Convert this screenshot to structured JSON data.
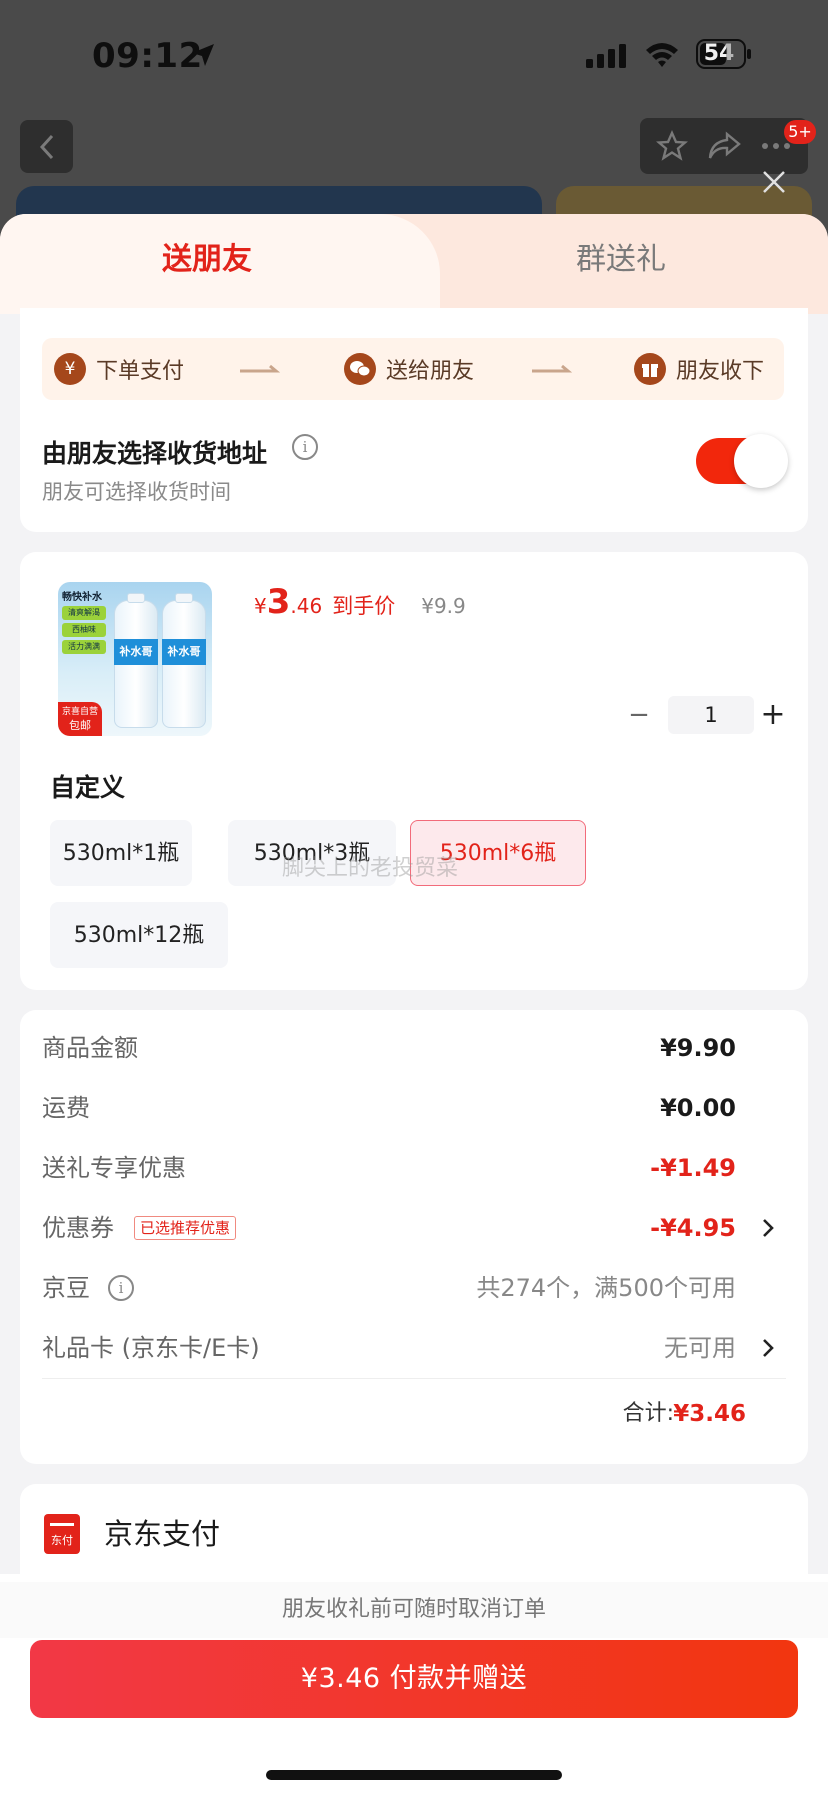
{
  "status_bar": {
    "time": "09:12",
    "battery": "54"
  },
  "nav": {
    "badge": "5+"
  },
  "tabs": [
    {
      "label": "送朋友",
      "active": true
    },
    {
      "label": "群送礼",
      "active": false
    }
  ],
  "steps": [
    {
      "label": "下单支付",
      "icon": "yen-circle-icon",
      "glyph": "¥"
    },
    {
      "label": "送给朋友",
      "icon": "wechat-icon"
    },
    {
      "label": "朋友收下",
      "icon": "gift-icon"
    }
  ],
  "address_option": {
    "title": "由朋友选择收货地址",
    "subtitle": "朋友可选择收货时间",
    "enabled": true
  },
  "product": {
    "image_text": {
      "tag": "畅快补水",
      "chips": [
        "清爽解渴",
        "西柚味",
        "活力满满"
      ],
      "bottle_label": "补水哥",
      "corner_top": "京喜自营",
      "corner_bottom": "包邮"
    },
    "price_symbol": "¥",
    "price_int": "3",
    "price_dec": ".46",
    "price_tag": "到手价",
    "original_price": "¥9.9",
    "quantity": "1",
    "spec_title": "自定义",
    "specs": [
      {
        "label": "530ml*1瓶",
        "selected": false
      },
      {
        "label": "530ml*3瓶",
        "selected": false
      },
      {
        "label": "530ml*6瓶",
        "selected": true
      },
      {
        "label": "530ml*12瓶",
        "selected": false
      }
    ],
    "watermark": "脚尖上的老投贸菜"
  },
  "summary": {
    "goods_label": "商品金额",
    "goods_value": "¥9.90",
    "shipping_label": "运费",
    "shipping_value": "¥0.00",
    "gift_discount_label": "送礼专享优惠",
    "gift_discount_value": "-¥1.49",
    "coupon_label": "优惠券",
    "coupon_tag": "已选推荐优惠",
    "coupon_value": "-¥4.95",
    "jd_beans_label": "京豆",
    "jd_beans_value": "共274个，满500个可用",
    "gift_card_label": "礼品卡 (京东卡/E卡)",
    "gift_card_value": "无可用",
    "total_label": "合计:",
    "total_value": "¥3.46"
  },
  "payment": {
    "icon_text": "东付",
    "name": "京东支付"
  },
  "footer": {
    "note": "朋友收礼前可随时取消订单",
    "pay_button": "¥3.46 付款并赠送"
  },
  "colors": {
    "accent": "#e2231a",
    "step_icon": "#a5471b",
    "tab_bg": "#fde8de"
  }
}
